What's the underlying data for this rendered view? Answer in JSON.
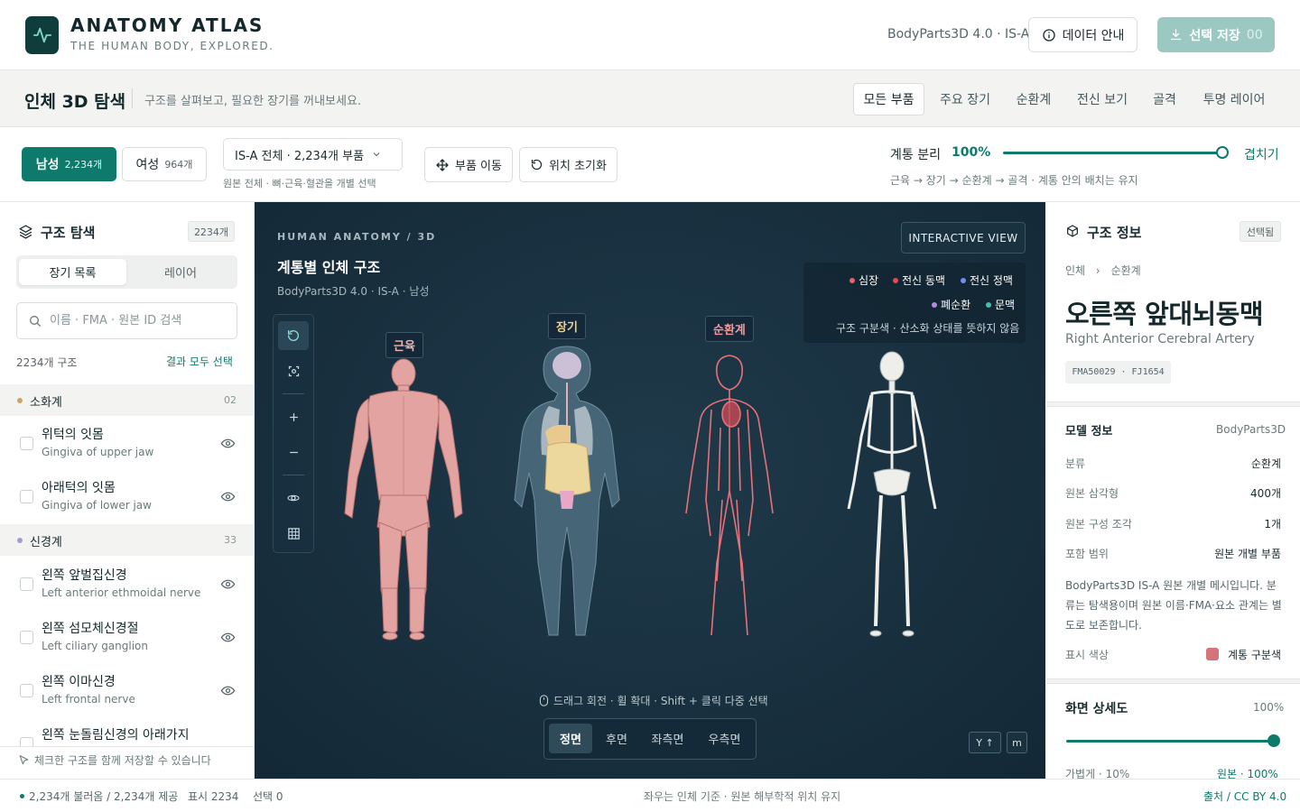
{
  "header": {
    "brand": "ANATOMY ATLAS",
    "tagline": "THE HUMAN BODY, EXPLORED.",
    "version": "BodyParts3D 4.0 · IS-A",
    "data_button": "데이터 안내",
    "save_button": "선택 저장",
    "save_count": "00"
  },
  "subheader": {
    "title": "인체 3D 탐색",
    "description": "구조를 살펴보고, 필요한 장기를 꺼내보세요.",
    "tabs": [
      {
        "label": "모든 부품"
      },
      {
        "label": "주요 장기"
      },
      {
        "label": "순환계"
      },
      {
        "label": "전신 보기"
      },
      {
        "label": "골격"
      },
      {
        "label": "투명 레이어"
      }
    ],
    "active_tab": "모든 부품"
  },
  "controls": {
    "male_label": "남성",
    "male_count": "2,234개",
    "female_label": "여성",
    "female_count": "964개",
    "selected_sex": "남성",
    "select_value": "IS-A 전체 · 2,234개 부품",
    "select_hint": "원본 전체 · 뼈·근육·혈관을 개별 선택",
    "move_button": "부품 이동",
    "reset_button": "위치 초기화",
    "separation_label": "계통 분리",
    "separation_value": "100%",
    "separation_fraction": 1.0,
    "separation_end": "겹치기",
    "separation_hint": "근육 → 장기 → 순환계 → 골격 · 계통 안의 배치는 유지"
  },
  "left_panel": {
    "title": "구조 탐색",
    "count_badge": "2234개",
    "seg_list": "장기 목록",
    "seg_layer": "레이어",
    "search_placeholder": "이름 · FMA · 원본 ID 검색",
    "result_count": "2234개 구조",
    "select_all": "결과 모두 선택",
    "groups": [
      {
        "name": "소화계",
        "count": "02",
        "color": "#c8a76a"
      },
      {
        "name": "신경계",
        "count": "33",
        "color": "#a99bd0"
      }
    ],
    "items": [
      {
        "ko": "위턱의 잇몸",
        "en": "Gingiva of upper jaw"
      },
      {
        "ko": "아래턱의 잇몸",
        "en": "Gingiva of lower jaw"
      },
      {
        "ko": "왼쪽 앞벌집신경",
        "en": "Left anterior ethmoidal nerve"
      },
      {
        "ko": "왼쪽 섬모체신경절",
        "en": "Left ciliary ganglion"
      },
      {
        "ko": "왼쪽 이마신경",
        "en": "Left frontal nerve"
      },
      {
        "ko": "왼쪽 눈돌림신경의 아래가지",
        "en": ""
      }
    ],
    "footer_hint": "체크한 구조를 함께 저장할 수 있습니다"
  },
  "viewer": {
    "eyebrow": "HUMAN ANATOMY / 3D",
    "title": "계통별 인체 구조",
    "subtitle": "BodyParts3D 4.0 · IS-A · 남성",
    "mode": "INTERACTIVE VIEW",
    "legend": [
      {
        "label": "심장",
        "color": "#e5616b"
      },
      {
        "label": "전신 동맥",
        "color": "#e8484f"
      },
      {
        "label": "전신 정맥",
        "color": "#6f8ff0"
      },
      {
        "label": "폐순환",
        "color": "#b18be0"
      },
      {
        "label": "문맥",
        "color": "#45c2a5"
      }
    ],
    "legend_note": "구조 구분색 · 산소화 상태를 뜻하지 않음",
    "body_labels": [
      {
        "label": "근육",
        "color": "#f2b3ab"
      },
      {
        "label": "장기",
        "color": "#f1cf87"
      },
      {
        "label": "순환계",
        "color": "#f29a9a"
      }
    ],
    "hint": "드래그 회전 · 휠 확대 · Shift + 클릭 다중 선택",
    "views": [
      {
        "label": "정면"
      },
      {
        "label": "후면"
      },
      {
        "label": "좌측면"
      },
      {
        "label": "우측면"
      }
    ],
    "active_view": "정면",
    "axis_button": "Y ↑",
    "mini_button": "m"
  },
  "right_panel": {
    "title": "구조 정보",
    "badge": "선택됨",
    "breadcrumb_root": "인체",
    "breadcrumb_leaf": "순환계",
    "part_ko": "오른쪽 앞대뇌동맥",
    "part_en": "Right Anterior Cerebral Artery",
    "part_id": "FMA50029 · FJ1654",
    "model_title": "모델 정보",
    "model_source": "BodyParts3D",
    "rows": [
      {
        "key": "분류",
        "value": "순환계"
      },
      {
        "key": "원본 삼각형",
        "value": "400개"
      },
      {
        "key": "원본 구성 조각",
        "value": "1개"
      },
      {
        "key": "포함 범위",
        "value": "원본 개별 부품"
      }
    ],
    "description": "BodyParts3D IS-A 원본 개별 메시입니다. 분류는 탐색용이며 원본 이름·FMA·요소 관계는 별도로 보존합니다.",
    "color_key": "표시 색상",
    "color_value": "계통 구분색",
    "color_swatch": "#d6737a",
    "detail_title": "화면 상세도",
    "detail_value": "100%",
    "detail_fraction": 1.0,
    "detail_low": "가볍게 · 10%",
    "detail_high": "원본 · 100%"
  },
  "footer": {
    "loaded": "2,234개 불러옴 / 2,234개 제공",
    "shown": "표시 2234",
    "selected": "선택 0",
    "center": "좌우는 인체 기준 · 원본 해부학적 위치 유지",
    "source": "출처 / CC BY 4.0"
  }
}
